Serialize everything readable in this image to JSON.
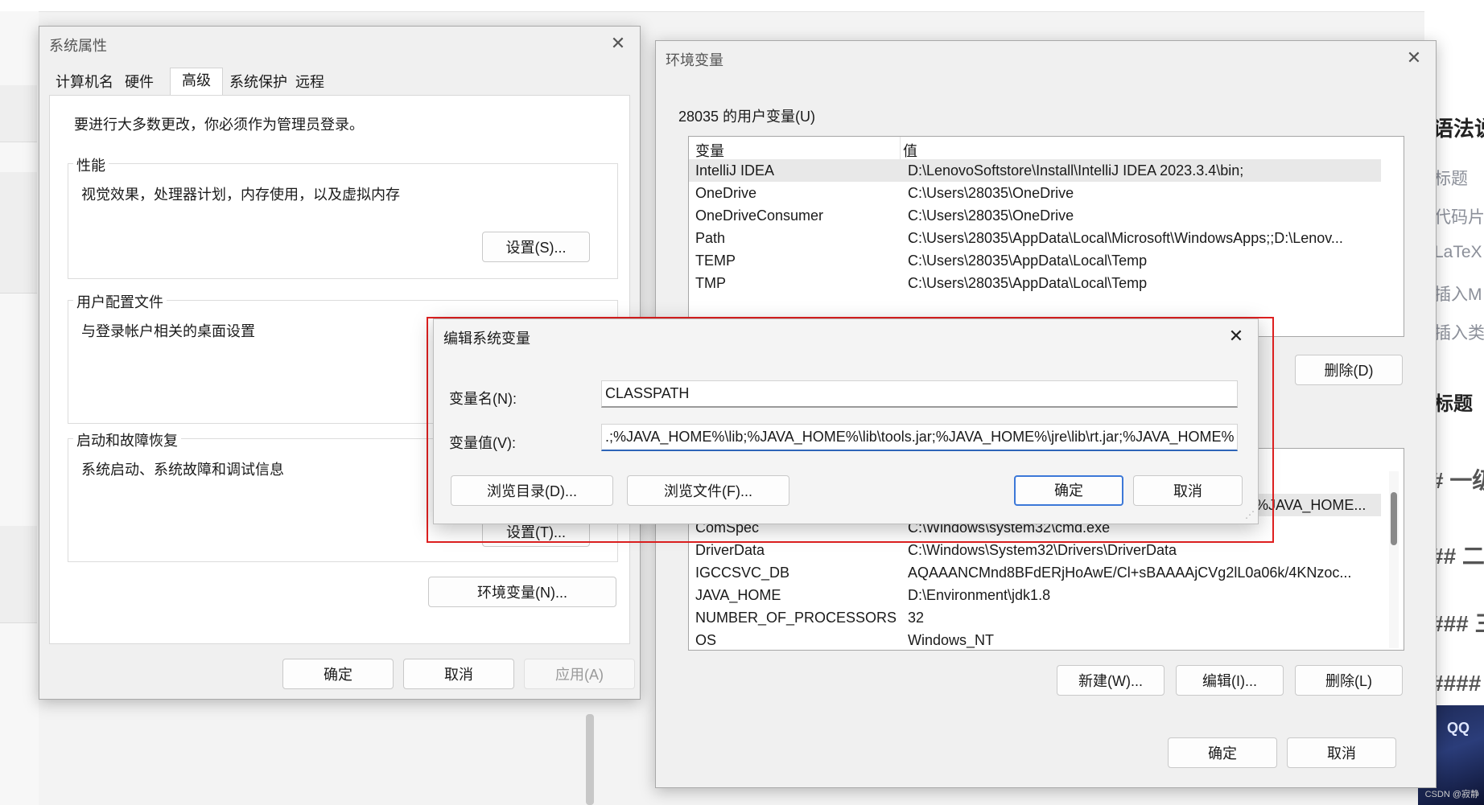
{
  "background": {
    "right_items": [
      "语法说",
      "标题",
      "代码片",
      "LaTeX",
      "插入M",
      "插入类"
    ],
    "right_heading": "标题",
    "right_hashes": [
      "# 一级",
      "## 二",
      "### 三",
      "####"
    ],
    "qq_label": "QQ",
    "watermark": "CSDN @寂静"
  },
  "system_properties": {
    "title": "系统属性",
    "close_label": "✕",
    "tabs": [
      "计算机名",
      "硬件",
      "高级",
      "系统保护",
      "远程"
    ],
    "active_tab": "高级",
    "admin_note": "要进行大多数更改，你必须作为管理员登录。",
    "performance": {
      "title": "性能",
      "desc": "视觉效果，处理器计划，内存使用，以及虚拟内存",
      "button": "设置(S)..."
    },
    "user_profiles": {
      "title": "用户配置文件",
      "desc": "与登录帐户相关的桌面设置"
    },
    "startup_recovery": {
      "title": "启动和故障恢复",
      "desc": "系统启动、系统故障和调试信息",
      "button_partial": "设置(T)..."
    },
    "env_button": "环境变量(N)...",
    "ok": "确定",
    "cancel": "取消",
    "apply": "应用(A)"
  },
  "env_vars": {
    "title": "环境变量",
    "close_label": "✕",
    "user_group_title": "28035 的用户变量(U)",
    "col_var": "变量",
    "col_val": "值",
    "user_rows": [
      {
        "name": "IntelliJ IDEA",
        "value": "D:\\LenovoSoftstore\\Install\\IntelliJ IDEA 2023.3.4\\bin;"
      },
      {
        "name": "OneDrive",
        "value": "C:\\Users\\28035\\OneDrive"
      },
      {
        "name": "OneDriveConsumer",
        "value": "C:\\Users\\28035\\OneDrive"
      },
      {
        "name": "Path",
        "value": "C:\\Users\\28035\\AppData\\Local\\Microsoft\\WindowsApps;;D:\\Lenov..."
      },
      {
        "name": "TEMP",
        "value": "C:\\Users\\28035\\AppData\\Local\\Temp"
      },
      {
        "name": "TMP",
        "value": "C:\\Users\\28035\\AppData\\Local\\Temp"
      }
    ],
    "user_delete": "删除(D)",
    "sys_partial_row_value": "%JAVA_HOME...",
    "system_rows": [
      {
        "name": "ComSpec",
        "value": "C:\\Windows\\system32\\cmd.exe"
      },
      {
        "name": "DriverData",
        "value": "C:\\Windows\\System32\\Drivers\\DriverData"
      },
      {
        "name": "IGCCSVC_DB",
        "value": "AQAAANCMnd8BFdERjHoAwE/Cl+sBAAAAjCVg2lL0a06k/4KNzoc..."
      },
      {
        "name": "JAVA_HOME",
        "value": "D:\\Environment\\jdk1.8"
      },
      {
        "name": "NUMBER_OF_PROCESSORS",
        "value": "32"
      },
      {
        "name": "OS",
        "value": "Windows_NT"
      }
    ],
    "sys_new": "新建(W)...",
    "sys_edit": "编辑(I)...",
    "sys_delete": "删除(L)",
    "ok": "确定",
    "cancel": "取消"
  },
  "edit_dialog": {
    "title": "编辑系统变量",
    "close_label": "✕",
    "name_label": "变量名(N):",
    "name_value": "CLASSPATH",
    "value_label": "变量值(V):",
    "value_value": ".;%JAVA_HOME%\\lib;%JAVA_HOME%\\lib\\tools.jar;%JAVA_HOME%\\jre\\lib\\rt.jar;%JAVA_HOME%\\bin",
    "browse_dir": "浏览目录(D)...",
    "browse_file": "浏览文件(F)...",
    "ok": "确定",
    "cancel": "取消"
  },
  "colors": {
    "highlight_border": "#e02020",
    "focus": "#2d64b8",
    "selected_row": "#e8e8e8"
  }
}
